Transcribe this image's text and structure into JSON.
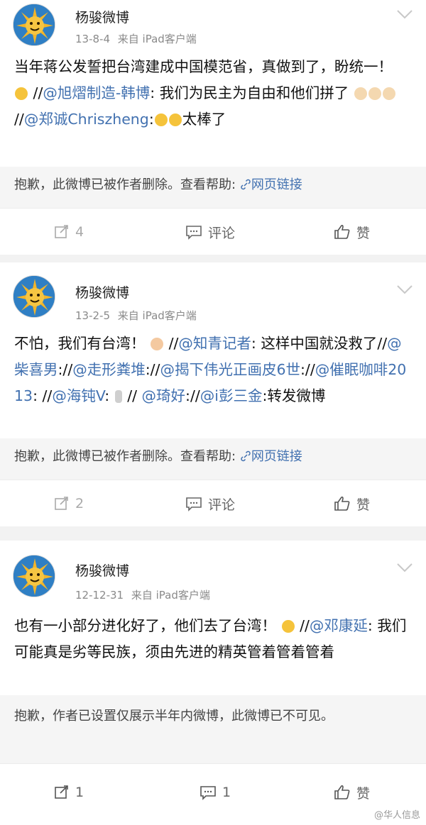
{
  "posts": [
    {
      "author": "杨骏微博",
      "date": "13-8-4",
      "source": "来自 iPad客户端",
      "text": {
        "p1": "当年蒋公发誓把台湾建成中国模范省，真做到了，盼统一！",
        "p2": " //",
        "m1": "@旭熠制造-韩博",
        "p3": ": 我们为民主为自由和他们拼了",
        "p4": " //",
        "m2": "@郑诚Chriszheng",
        "p5": ":",
        "p6": "太棒了"
      },
      "quote": {
        "text": "抱歉，此微博已被作者删除。查看帮助:",
        "link": "网页链接"
      },
      "actions": {
        "repost": "4",
        "comment": "评论",
        "like": "赞"
      }
    },
    {
      "author": "杨骏微博",
      "date": "13-2-5",
      "source": "来自 iPad客户端",
      "text": {
        "p1": "不怕，我们有台湾！",
        "p2": " //",
        "m1": "@知青记者",
        "p3": ": 这样中国就没救了//",
        "m2": "@柴喜男",
        "p4": "://",
        "m3": "@走形粪堆",
        "p5": "://",
        "m4": "@揭下伟光正画皮6世",
        "p6": "://",
        "m5": "@催眠咖啡2013",
        "p7": ": //",
        "m6": "@海钝V",
        "p8": ":",
        "p9": " //",
        "m7": "@琦好",
        "p10": "://",
        "m8": "@i彭三金",
        "p11": ":转发微博"
      },
      "quote": {
        "text": "抱歉，此微博已被作者删除。查看帮助:",
        "link": "网页链接"
      },
      "actions": {
        "repost": "2",
        "comment": "评论",
        "like": "赞"
      }
    },
    {
      "author": "杨骏微博",
      "date": "12-12-31",
      "source": "来自 iPad客户端",
      "text": {
        "p1": "也有一小部分进化好了，他们去了台湾！",
        "p2": " //",
        "m1": "@邓康延",
        "p3": ": 我们可能真是劣等民族，须由先进的精英管着管着管着"
      },
      "quote": {
        "text": "抱歉，作者已设置仅展示半年内微博，此微博已不可见。"
      },
      "actions": {
        "repost": "1",
        "comment": "1",
        "like": "赞"
      }
    }
  ],
  "watermark": "@华人信息",
  "icons": [
    "sun-avatar",
    "chevron-down-icon",
    "repost-icon",
    "comment-icon",
    "like-icon",
    "link-icon"
  ],
  "colors": {
    "mention": "#4271b0",
    "quote_bg": "#f5f5f5",
    "page_bg": "#f2f2f2"
  }
}
